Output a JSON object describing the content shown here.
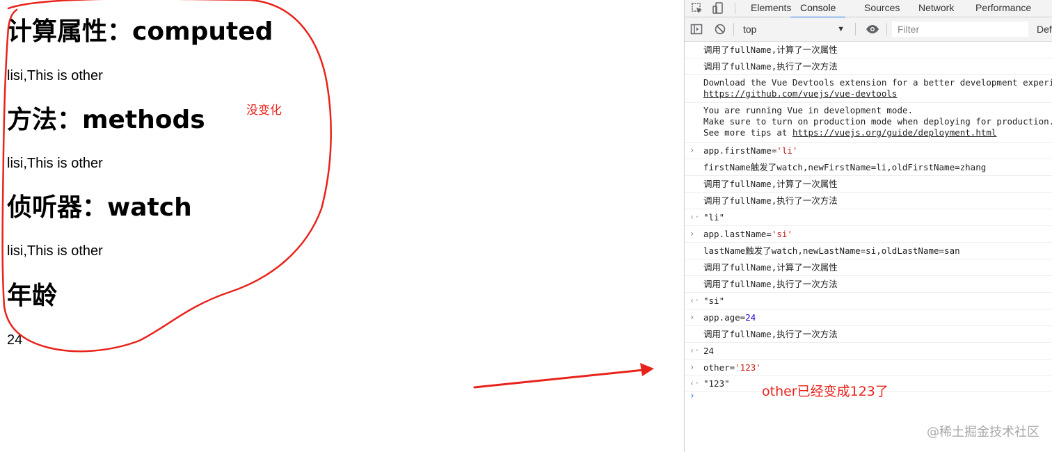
{
  "left": {
    "sections": [
      {
        "heading": "计算属性：computed",
        "value": "lisi,This is other"
      },
      {
        "heading": "方法：methods",
        "value": "lisi,This is other"
      },
      {
        "heading": "侦听器：watch",
        "value": "lisi,This is other"
      },
      {
        "heading": "年龄",
        "value": "24"
      }
    ]
  },
  "annotations": {
    "unchanged": "没变化",
    "other_changed": "other已经变成123了",
    "color": "#e8231b"
  },
  "devtools": {
    "tabs": [
      "Elements",
      "Console",
      "Sources",
      "Network",
      "Performance"
    ],
    "active_tab": "Console",
    "context": "top",
    "filter_placeholder": "Filter",
    "levels": "Def",
    "prompt": "›",
    "logs": [
      {
        "kind": "log",
        "text": "调用了fullName,计算了一次属性"
      },
      {
        "kind": "log",
        "text": "调用了fullName,执行了一次方法"
      },
      {
        "kind": "info",
        "line1": "Download the Vue Devtools extension for a better development experience:",
        "link": "https://github.com/vuejs/vue-devtools"
      },
      {
        "kind": "info",
        "line1": "You are running Vue in development mode.",
        "line2": "Make sure to turn on production mode when deploying for production.",
        "line3_prefix": "See more tips at ",
        "link": "https://vuejs.org/guide/deployment.html"
      },
      {
        "kind": "input",
        "code": "app.firstName=",
        "arg": "'li'"
      },
      {
        "kind": "log",
        "text": "firstName触发了watch,newFirstName=li,oldFirstName=zhang"
      },
      {
        "kind": "log",
        "text": "调用了fullName,计算了一次属性"
      },
      {
        "kind": "log",
        "text": "调用了fullName,执行了一次方法"
      },
      {
        "kind": "result",
        "text": "\"li\""
      },
      {
        "kind": "input",
        "code": "app.lastName=",
        "arg": "'si'"
      },
      {
        "kind": "log",
        "text": "lastName触发了watch,newLastName=si,oldLastName=san"
      },
      {
        "kind": "log",
        "text": "调用了fullName,计算了一次属性"
      },
      {
        "kind": "log",
        "text": "调用了fullName,执行了一次方法"
      },
      {
        "kind": "result",
        "text": "\"si\""
      },
      {
        "kind": "input",
        "code": "app.age=",
        "arg": "24"
      },
      {
        "kind": "log",
        "text": "调用了fullName,执行了一次方法"
      },
      {
        "kind": "result",
        "text": "24"
      },
      {
        "kind": "input",
        "code": "other=",
        "arg": "'123'"
      },
      {
        "kind": "result",
        "text": "\"123\""
      }
    ]
  },
  "watermark": "@稀土掘金技术社区"
}
